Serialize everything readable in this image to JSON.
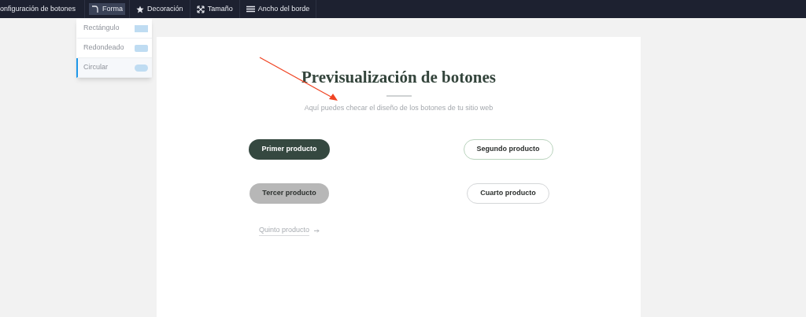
{
  "toolbar": [
    {
      "label": "onfiguración de botones",
      "kind": "plain",
      "selected": false
    },
    {
      "label": "Forma",
      "kind": "shape",
      "selected": true
    },
    {
      "label": "Decoración",
      "kind": "decoration",
      "selected": false
    },
    {
      "label": "Tamaño",
      "kind": "size",
      "selected": false
    },
    {
      "label": "Ancho del borde",
      "kind": "border",
      "selected": false
    }
  ],
  "shape_menu": [
    {
      "label": "Rectángulo",
      "kind": "rectangle",
      "selected": false
    },
    {
      "label": "Redondeado",
      "kind": "rounded",
      "selected": false
    },
    {
      "label": "Circular",
      "kind": "circular",
      "selected": true
    }
  ],
  "preview": {
    "title": "Previsualización de botones",
    "subtitle": "Aquí puedes checar el diseño de los botones de tu sitio web",
    "buttons": [
      {
        "label": "Primer producto",
        "kind": "filled"
      },
      {
        "label": "Segundo producto",
        "kind": "outline-green"
      },
      {
        "label": "Tercer producto",
        "kind": "grey"
      },
      {
        "label": "Cuarto producto",
        "kind": "outline"
      },
      {
        "label": "Quinto producto",
        "kind": "link"
      }
    ]
  }
}
